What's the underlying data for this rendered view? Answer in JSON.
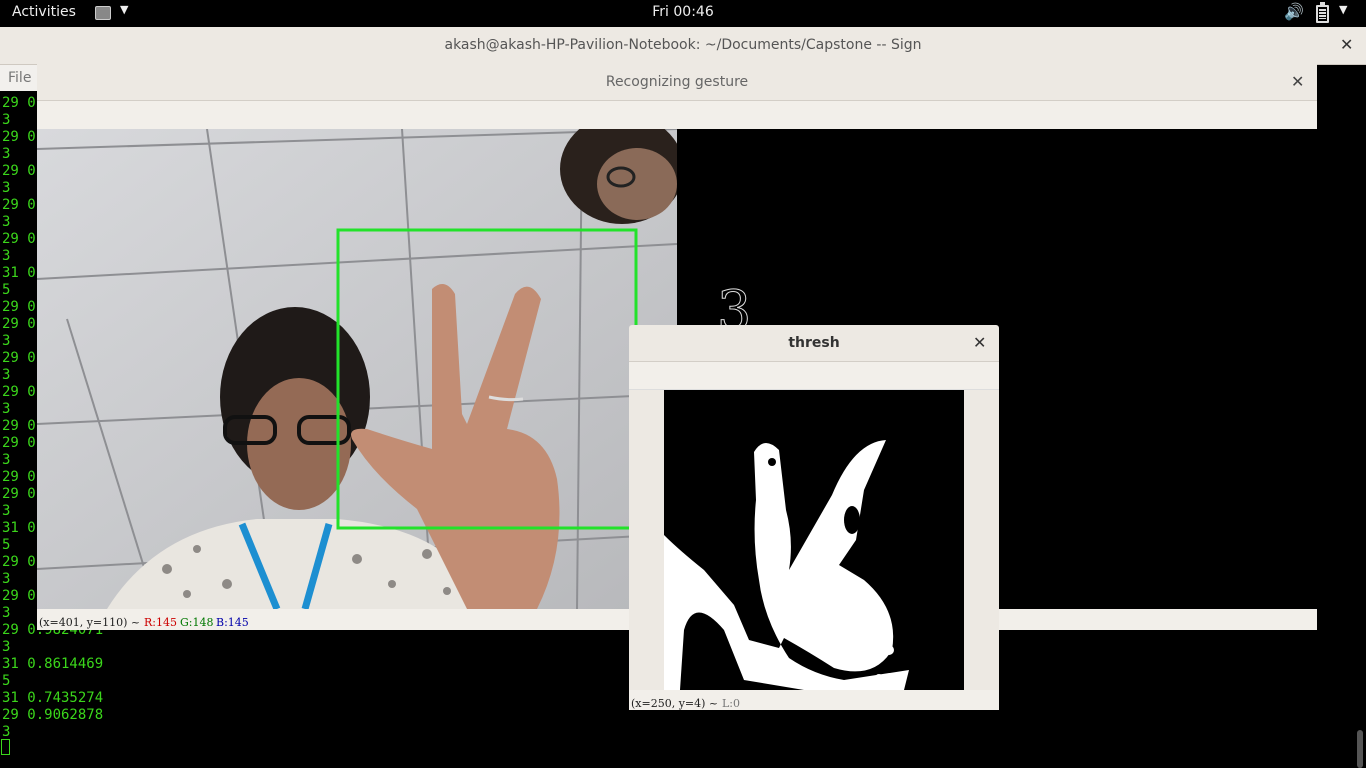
{
  "topbar": {
    "activities": "Activities",
    "clock": "Fri 00:46"
  },
  "terminal": {
    "title": "akash@akash-HP-Pavilion-Notebook: ~/Documents/Capstone -- Sign",
    "menu_file": "File",
    "lines": [
      "29 0",
      "3",
      "29 0",
      "3",
      "29 0",
      "3",
      "29 0",
      "3",
      "29 0",
      "3",
      "31 0",
      "5",
      "29 0",
      "29 0",
      "3",
      "29 0",
      "3",
      "29 0",
      "3",
      "29 0",
      "29 0",
      "3",
      "29 0",
      "29 0",
      "3",
      "31 0",
      "5",
      "29 0",
      "3",
      "29 0",
      "3",
      "29 0.9824071",
      "3",
      "31 0.8614469",
      "5",
      "31 0.7435274",
      "29 0.9062878",
      "3"
    ]
  },
  "gesture_window": {
    "title": "Recognizing gesture",
    "predicted_digit": "3",
    "status": {
      "coords": "(x=401, y=110) ~ ",
      "r": "R:145",
      "g": "G:148",
      "b": "B:145"
    },
    "colors": {
      "roi": "#22e22a",
      "r": "#cc0000",
      "g": "#007700",
      "b": "#0000aa"
    }
  },
  "thresh_window": {
    "title": "thresh",
    "status": {
      "coords": "(x=250, y=4) ~ ",
      "l": "L:0"
    }
  },
  "icons": [
    "app-menu-icon",
    "volume-icon",
    "battery-icon",
    "close-icon"
  ]
}
